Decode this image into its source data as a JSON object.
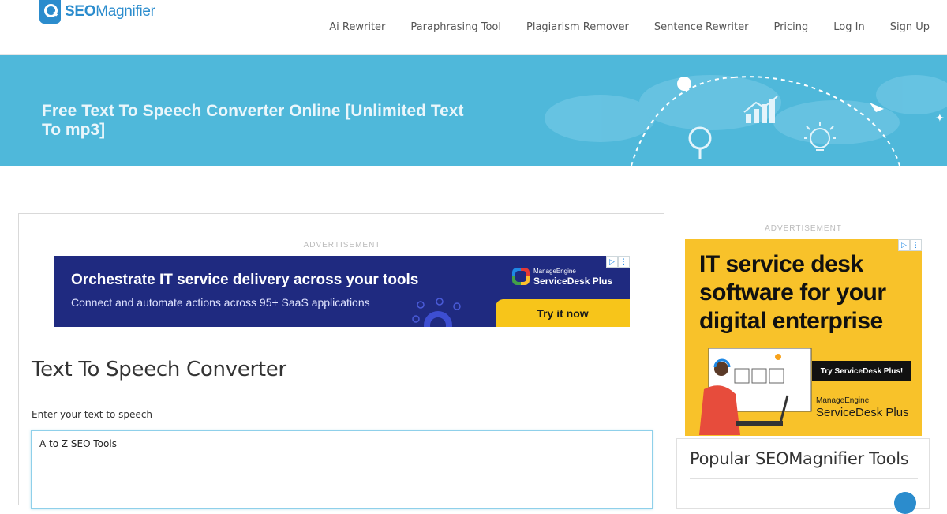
{
  "brand": {
    "logo_bold": "SEO",
    "logo_light": "Magnifier",
    "logo_icon": "magnifier-icon"
  },
  "nav": {
    "items": [
      {
        "label": "Ai Rewriter"
      },
      {
        "label": "Paraphrasing Tool"
      },
      {
        "label": "Plagiarism Remover"
      },
      {
        "label": "Sentence Rewriter"
      },
      {
        "label": "Pricing"
      },
      {
        "label": "Log In"
      },
      {
        "label": "Sign Up"
      }
    ]
  },
  "hero": {
    "title": "Free Text To Speech Converter Online [Unlimited Text To mp3]",
    "background": "#4fb8da",
    "icons": [
      "globe-map-icon",
      "bar-chart-icon",
      "magnifier-icon",
      "lightbulb-icon",
      "cursor-arrow-icon"
    ]
  },
  "main_ad": {
    "label": "ADVERTISEMENT",
    "headline": "Orchestrate IT service delivery across your tools",
    "subline": "Connect and automate actions across 95+ SaaS applications",
    "brand_small": "ManageEngine",
    "brand_big": "ServiceDesk Plus",
    "cta": "Try it now",
    "colors": {
      "bg": "#1f2a80",
      "cta": "#f7c51a"
    }
  },
  "tool": {
    "title": "Text To Speech Converter",
    "input_label": "Enter your text to speech",
    "input_value": "A to Z SEO Tools"
  },
  "side_ad": {
    "label": "ADVERTISEMENT",
    "headline": "IT service desk software for your digital enterprise",
    "cta": "Try ServiceDesk Plus!",
    "brand_small": "ManageEngine",
    "brand_big": "ServiceDesk Plus",
    "colors": {
      "bg": "#f8c22a"
    }
  },
  "popular": {
    "title": "Popular SEOMagnifier Tools"
  }
}
